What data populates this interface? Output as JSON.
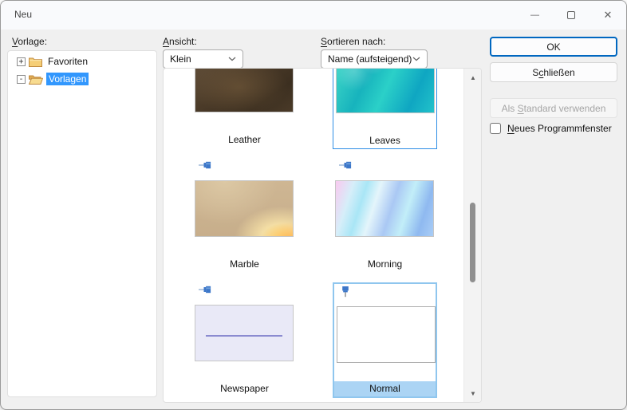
{
  "window": {
    "title": "Neu",
    "controls": {
      "minimize": "—",
      "close": "✕"
    }
  },
  "left_panel": {
    "label": {
      "key": "V",
      "rest": "orlage:"
    },
    "tree": [
      {
        "label": "Favoriten",
        "expander": "+",
        "state": "collapsed",
        "selected": false,
        "icon": "closed-folder"
      },
      {
        "label": "Vorlagen",
        "expander": "-",
        "state": "expanded",
        "selected": true,
        "icon": "open-folder"
      }
    ]
  },
  "toolbar": {
    "view": {
      "label": {
        "key": "A",
        "rest": "nsicht:"
      },
      "value": "Klein"
    },
    "sort": {
      "label": {
        "key": "S",
        "rest": "ortieren nach:"
      },
      "value": "Name (aufsteigend)"
    }
  },
  "gallery": {
    "items": [
      {
        "name": "Leather",
        "selected": false,
        "pinned": false
      },
      {
        "name": "Leaves",
        "selected": "outline",
        "pinned": false
      },
      {
        "name": "Marble",
        "selected": false,
        "pinned": false
      },
      {
        "name": "Morning",
        "selected": false,
        "pinned": false
      },
      {
        "name": "Newspaper",
        "selected": false,
        "pinned": false
      },
      {
        "name": "Normal",
        "selected": "highlight",
        "pinned": true
      }
    ],
    "scroll": {
      "up_icon": "▲",
      "down_icon": "▼"
    }
  },
  "actions": {
    "ok": {
      "label": "OK"
    },
    "close": {
      "pre": "S",
      "key": "c",
      "rest": "hließen"
    },
    "make_default": {
      "pre": "Als ",
      "key": "S",
      "rest": "tandard verwenden",
      "disabled": true
    }
  },
  "options": {
    "new_window": {
      "key": "N",
      "rest": "eues Programmfenster",
      "checked": false
    }
  },
  "colors": {
    "accent_border": "#0067C0",
    "tree_selection": "#3297FD",
    "gallery_outline_selection": "#2E8EE5",
    "pinned_cell_border": "#8FC6EE",
    "pinned_label_bg": "#ABD4F4",
    "pin_blue": "#3D77C9"
  }
}
